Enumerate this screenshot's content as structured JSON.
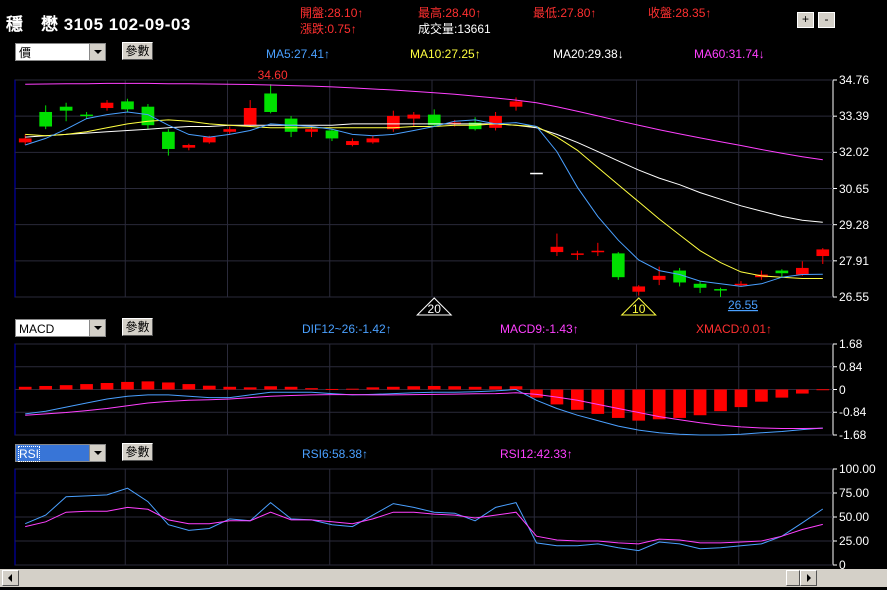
{
  "header": {
    "title": "穩　懋 3105 102-09-03",
    "open": "開盤:28.10↑",
    "change": "漲跌:0.75↑",
    "high": "最高:28.40↑",
    "volume": "成交量:13661",
    "low": "最低:27.80↑",
    "close": "收盤:28.35↑",
    "zoom_in": "+",
    "zoom_out": "-"
  },
  "price_panel": {
    "select": "價",
    "param_button": "參數",
    "ma5": "MA5:27.41↑",
    "ma10": "MA10:27.25↑",
    "ma20": "MA20:29.38↓",
    "ma60": "MA60:31.74↓",
    "high_marker": "34.60",
    "low_marker": "26.55",
    "tri_labels": [
      "20",
      "10"
    ],
    "y_ticks": [
      "34.76",
      "33.39",
      "32.02",
      "30.65",
      "29.28",
      "27.91",
      "26.55"
    ]
  },
  "macd_panel": {
    "select": "MACD",
    "param_button": "參數",
    "dif": "DIF12~26:-1.42↑",
    "macd9": "MACD9:-1.43↑",
    "xmacd": "XMACD:0.01↑",
    "y_ticks": [
      "1.68",
      "0.84",
      "0",
      "-0.84",
      "-1.68"
    ]
  },
  "rsi_panel": {
    "select": "RSI",
    "param_button": "參數",
    "rsi6": "RSI6:58.38↑",
    "rsi12": "RSI12:42.33↑",
    "y_ticks": [
      "100.00",
      "75.00",
      "50.00",
      "25.00",
      "0"
    ]
  },
  "colors": {
    "up": "#ff0000",
    "down": "#00e000",
    "ma5": "#4aa0ff",
    "ma10": "#ffff40",
    "ma20": "#ffffff",
    "ma60": "#ff40ff",
    "frame": "#0000c8"
  },
  "chart_data": {
    "type": "candlestick",
    "candles": [
      {
        "o": 32.4,
        "c": 32.55,
        "h": 32.7,
        "l": 32.3
      },
      {
        "o": 33.55,
        "c": 33.0,
        "h": 33.8,
        "l": 32.9
      },
      {
        "o": 33.75,
        "c": 33.6,
        "h": 33.9,
        "l": 33.2
      },
      {
        "o": 33.45,
        "c": 33.4,
        "h": 33.55,
        "l": 33.3
      },
      {
        "o": 33.7,
        "c": 33.9,
        "h": 34.0,
        "l": 33.6
      },
      {
        "o": 33.95,
        "c": 33.65,
        "h": 34.05,
        "l": 33.55
      },
      {
        "o": 33.75,
        "c": 33.05,
        "h": 33.85,
        "l": 32.9
      },
      {
        "o": 32.8,
        "c": 32.15,
        "h": 32.9,
        "l": 31.9
      },
      {
        "o": 32.2,
        "c": 32.3,
        "h": 32.35,
        "l": 32.1
      },
      {
        "o": 32.4,
        "c": 32.6,
        "h": 32.65,
        "l": 32.35
      },
      {
        "o": 32.8,
        "c": 32.9,
        "h": 33.0,
        "l": 32.7
      },
      {
        "o": 33.05,
        "c": 33.7,
        "h": 34.0,
        "l": 33.0
      },
      {
        "o": 34.25,
        "c": 33.55,
        "h": 34.6,
        "l": 33.5
      },
      {
        "o": 33.3,
        "c": 32.8,
        "h": 33.4,
        "l": 32.6
      },
      {
        "o": 32.8,
        "c": 32.9,
        "h": 33.0,
        "l": 32.6
      },
      {
        "o": 32.85,
        "c": 32.55,
        "h": 32.9,
        "l": 32.45
      },
      {
        "o": 32.3,
        "c": 32.45,
        "h": 32.55,
        "l": 32.25
      },
      {
        "o": 32.4,
        "c": 32.55,
        "h": 32.65,
        "l": 32.35
      },
      {
        "o": 32.9,
        "c": 33.4,
        "h": 33.6,
        "l": 32.8
      },
      {
        "o": 33.3,
        "c": 33.45,
        "h": 33.55,
        "l": 33.0
      },
      {
        "o": 33.45,
        "c": 33.05,
        "h": 33.65,
        "l": 33.0
      },
      {
        "o": 33.1,
        "c": 33.15,
        "h": 33.25,
        "l": 33.0
      },
      {
        "o": 33.15,
        "c": 32.9,
        "h": 33.35,
        "l": 32.85
      },
      {
        "o": 32.95,
        "c": 33.4,
        "h": 33.55,
        "l": 32.85
      },
      {
        "o": 33.75,
        "c": 33.95,
        "h": 34.1,
        "l": 33.6
      },
      {
        "o": 31.25,
        "c": 31.25,
        "h": 31.25,
        "l": 31.25
      },
      {
        "o": 28.25,
        "c": 28.45,
        "h": 28.95,
        "l": 28.1
      },
      {
        "o": 28.15,
        "c": 28.2,
        "h": 28.3,
        "l": 27.95
      },
      {
        "o": 28.25,
        "c": 28.3,
        "h": 28.6,
        "l": 28.1
      },
      {
        "o": 28.2,
        "c": 27.3,
        "h": 28.25,
        "l": 27.2
      },
      {
        "o": 26.75,
        "c": 26.95,
        "h": 27.0,
        "l": 26.6
      },
      {
        "o": 27.2,
        "c": 27.35,
        "h": 27.7,
        "l": 27.0
      },
      {
        "o": 27.55,
        "c": 27.1,
        "h": 27.65,
        "l": 26.95
      },
      {
        "o": 27.05,
        "c": 26.9,
        "h": 27.15,
        "l": 26.7
      },
      {
        "o": 26.85,
        "c": 26.8,
        "h": 26.9,
        "l": 26.55
      },
      {
        "o": 27.0,
        "c": 27.05,
        "h": 27.15,
        "l": 26.95
      },
      {
        "o": 27.3,
        "c": 27.4,
        "h": 27.55,
        "l": 27.2
      },
      {
        "o": 27.55,
        "c": 27.45,
        "h": 27.6,
        "l": 27.3
      },
      {
        "o": 27.4,
        "c": 27.65,
        "h": 27.9,
        "l": 27.35
      },
      {
        "o": 28.1,
        "c": 28.35,
        "h": 28.4,
        "l": 27.8
      }
    ],
    "ma5": [
      32.3,
      32.55,
      32.9,
      33.3,
      33.45,
      33.55,
      33.45,
      33.05,
      32.7,
      32.6,
      32.7,
      32.85,
      33.1,
      33.05,
      33.0,
      32.9,
      32.7,
      32.65,
      32.7,
      32.85,
      33.0,
      33.2,
      33.25,
      33.1,
      33.15,
      33.0,
      32.05,
      30.7,
      29.6,
      28.7,
      27.95,
      27.55,
      27.4,
      27.15,
      27.05,
      26.95,
      27.05,
      27.3,
      27.4,
      27.41
    ],
    "ma10": [
      32.7,
      32.65,
      32.7,
      32.8,
      32.95,
      33.1,
      33.2,
      33.25,
      33.2,
      33.1,
      33.05,
      33.0,
      32.95,
      32.95,
      32.95,
      32.95,
      32.95,
      32.95,
      32.95,
      33.0,
      33.0,
      33.05,
      33.05,
      33.1,
      33.05,
      33.0,
      32.6,
      32.1,
      31.45,
      30.8,
      30.15,
      29.5,
      28.9,
      28.3,
      27.85,
      27.5,
      27.35,
      27.3,
      27.25,
      27.25
    ],
    "ma20": [
      32.6,
      32.65,
      32.7,
      32.75,
      32.8,
      32.85,
      32.9,
      32.95,
      33.0,
      33.0,
      33.05,
      33.05,
      33.05,
      33.05,
      33.05,
      33.05,
      33.1,
      33.1,
      33.1,
      33.1,
      33.1,
      33.1,
      33.1,
      33.1,
      33.05,
      32.95,
      32.7,
      32.4,
      32.05,
      31.7,
      31.35,
      31.05,
      30.8,
      30.5,
      30.25,
      30.0,
      29.8,
      29.6,
      29.45,
      29.38
    ],
    "ma60": [
      34.6,
      34.61,
      34.62,
      34.62,
      34.63,
      34.63,
      34.63,
      34.62,
      34.62,
      34.61,
      34.6,
      34.59,
      34.57,
      34.55,
      34.53,
      34.5,
      34.46,
      34.42,
      34.38,
      34.33,
      34.28,
      34.22,
      34.15,
      34.08,
      34.0,
      33.9,
      33.75,
      33.58,
      33.4,
      33.22,
      33.05,
      32.88,
      32.72,
      32.57,
      32.42,
      32.28,
      32.13,
      31.99,
      31.86,
      31.74
    ],
    "macd_hist": [
      0.1,
      0.13,
      0.16,
      0.2,
      0.24,
      0.28,
      0.3,
      0.26,
      0.2,
      0.14,
      0.1,
      0.08,
      0.12,
      0.1,
      0.05,
      0.02,
      0.03,
      0.08,
      0.1,
      0.12,
      0.13,
      0.12,
      0.1,
      0.12,
      0.12,
      -0.3,
      -0.55,
      -0.75,
      -0.9,
      -1.05,
      -1.15,
      -1.1,
      -1.05,
      -0.95,
      -0.8,
      -0.65,
      -0.45,
      -0.3,
      -0.15,
      0.01
    ],
    "dif": [
      -0.9,
      -0.8,
      -0.65,
      -0.5,
      -0.35,
      -0.25,
      -0.2,
      -0.2,
      -0.25,
      -0.3,
      -0.3,
      -0.2,
      -0.1,
      -0.1,
      -0.1,
      -0.15,
      -0.2,
      -0.18,
      -0.15,
      -0.12,
      -0.1,
      -0.1,
      -0.08,
      -0.05,
      0.0,
      -0.4,
      -0.7,
      -0.95,
      -1.15,
      -1.35,
      -1.5,
      -1.6,
      -1.65,
      -1.68,
      -1.68,
      -1.65,
      -1.6,
      -1.55,
      -1.48,
      -1.42
    ],
    "macd9": [
      -0.95,
      -0.9,
      -0.85,
      -0.78,
      -0.7,
      -0.6,
      -0.5,
      -0.44,
      -0.4,
      -0.38,
      -0.35,
      -0.3,
      -0.25,
      -0.22,
      -0.2,
      -0.19,
      -0.19,
      -0.2,
      -0.2,
      -0.19,
      -0.18,
      -0.17,
      -0.16,
      -0.15,
      -0.12,
      -0.18,
      -0.28,
      -0.4,
      -0.55,
      -0.7,
      -0.85,
      -1.0,
      -1.12,
      -1.23,
      -1.32,
      -1.38,
      -1.42,
      -1.44,
      -1.44,
      -1.43
    ],
    "rsi6": [
      43,
      52,
      71,
      72,
      73,
      80,
      66,
      42,
      36,
      38,
      48,
      46,
      65,
      48,
      47,
      42,
      40,
      52,
      64,
      60,
      55,
      54,
      46,
      60,
      65,
      23,
      20,
      20,
      22,
      18,
      15,
      24,
      22,
      17,
      18,
      20,
      22,
      30,
      44,
      58.38
    ],
    "rsi12": [
      40,
      45,
      55,
      56,
      56,
      60,
      58,
      47,
      43,
      43,
      46,
      46,
      55,
      47,
      47,
      45,
      43,
      48,
      55,
      55,
      53,
      52,
      49,
      52,
      55,
      30,
      26,
      25,
      25,
      23,
      22,
      27,
      26,
      23,
      23,
      24,
      25,
      30,
      37,
      42.33
    ],
    "price_range": [
      26.55,
      34.76
    ],
    "macd_range": [
      -1.68,
      1.68
    ],
    "rsi_range": [
      0,
      100
    ]
  }
}
